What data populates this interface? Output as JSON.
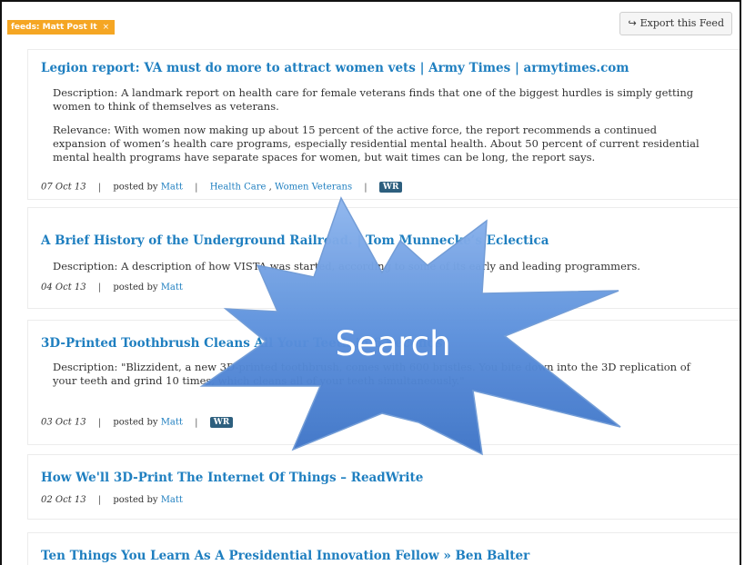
{
  "filter_tag": {
    "label": "feeds: Matt Post It",
    "close": "×"
  },
  "export_button": {
    "icon": "↪",
    "label": "Export this Feed"
  },
  "items": [
    {
      "title": "Legion report: VA must do more to attract women vets | Army Times | armytimes.com",
      "description": "Description:  A landmark report on health care for female veterans finds that one of the biggest hurdles is simply getting women to think of themselves as veterans.",
      "relevance": "Relevance:  With women now making up about 15 percent of the active force, the report recommends a continued expansion of women’s health care programs, especially residential mental health. About 50 percent of current residential mental health programs have separate spaces for women, but wait times can be long, the report says.",
      "date": "07 Oct 13",
      "posted_by": "posted by",
      "author": "Matt",
      "tags": [
        "Health Care",
        "Women Veterans"
      ],
      "badge": "WR"
    },
    {
      "title": "A Brief History of the Underground Railroad. | Tom Munnecke’s Eclectica",
      "description": "Description:  A description of how VISTA was started, according to some of its early and leading programmers.",
      "date": "04 Oct 13",
      "posted_by": "posted by",
      "author": "Matt"
    },
    {
      "title": "3D-Printed Toothbrush Cleans All Your Teeth in 6 Seconds",
      "description": "Description:  \"Blizzident, a new 3D-printed toothbrush, comes with 600 bristles. You bite down into the 3D replication of your teeth and grind 10 times, which cleans all of your teeth simultaneously.\"",
      "date": "03 Oct 13",
      "posted_by": "posted by",
      "author": "Matt",
      "badge": "WR"
    },
    {
      "title": "How We'll 3D-Print The Internet Of Things – ReadWrite",
      "date": "02 Oct 13",
      "posted_by": "posted by",
      "author": "Matt"
    },
    {
      "title": "Ten Things You Learn As A Presidential Innovation Fellow » Ben Balter"
    }
  ],
  "overlay": {
    "label": "Search"
  },
  "colors": {
    "accent": "#1f7fc0",
    "tag": "#f5a623",
    "badge": "#2d5f7e",
    "burst": "#4f86d6"
  }
}
